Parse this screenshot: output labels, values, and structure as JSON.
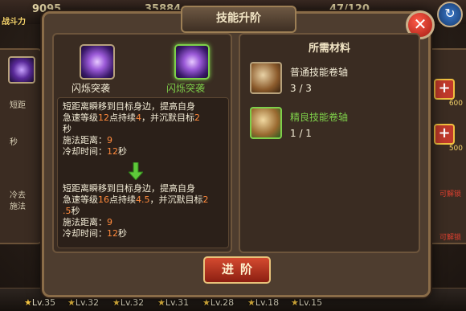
{
  "topbar": {
    "power_label": "战斗力",
    "stat1": "9095",
    "stat2": "35884",
    "stat3": "47/120"
  },
  "dialog": {
    "title": "技能升阶",
    "close_label": "✕",
    "skill": {
      "current_name": "闪烁突袭",
      "next_name": "闪烁突袭",
      "current_desc": {
        "line1_a": "短距离瞬移到目标身边，提高自身",
        "line2_a": "急速等级",
        "line2_num": "12",
        "line2_b": "点持续",
        "line2_num2": "4",
        "line2_c": "，并沉默目标",
        "line2_num3": "2",
        "line3": "秒",
        "range_label": "施法距离：",
        "range_val": "9",
        "cd_label": "冷却时间：",
        "cd_val": "12",
        "cd_unit": "秒"
      },
      "next_desc": {
        "line1_a": "短距离瞬移到目标身边，提高自身",
        "line2_a": "急速等级",
        "line2_num": "16",
        "line2_b": "点持续",
        "line2_num2": "4.5",
        "line2_c": "，并沉默目标",
        "line2_num3": "2",
        "line3_num": ".5",
        "line3": "秒",
        "range_label": "施法距离：",
        "range_val": "9",
        "cd_label": "冷却时间：",
        "cd_val": "12",
        "cd_unit": "秒"
      }
    },
    "materials": {
      "title": "所需材料",
      "items": [
        {
          "name": "普通技能卷轴",
          "count": "3 / 3",
          "color": "#f3ecd6"
        },
        {
          "name": "精良技能卷轴",
          "count": "1 / 1",
          "color": "#7ed04a"
        }
      ]
    },
    "advance_button": "进阶"
  },
  "side": {
    "gold1": "600",
    "gold2": "500",
    "unlock1": "可解锁",
    "unlock2": "可解锁",
    "left_text1": "短距",
    "left_text2": "秒",
    "left_text3": "冷去",
    "left_text4": "施法"
  },
  "bottom_levels": [
    "Lv.35",
    "Lv.32",
    "Lv.32",
    "Lv.31",
    "Lv.28",
    "Lv.18",
    "Lv.15"
  ],
  "colors": {
    "highlight_orange": "#ff8a3d",
    "next_green": "#7ed04a",
    "button_red": "#d44a2f"
  }
}
